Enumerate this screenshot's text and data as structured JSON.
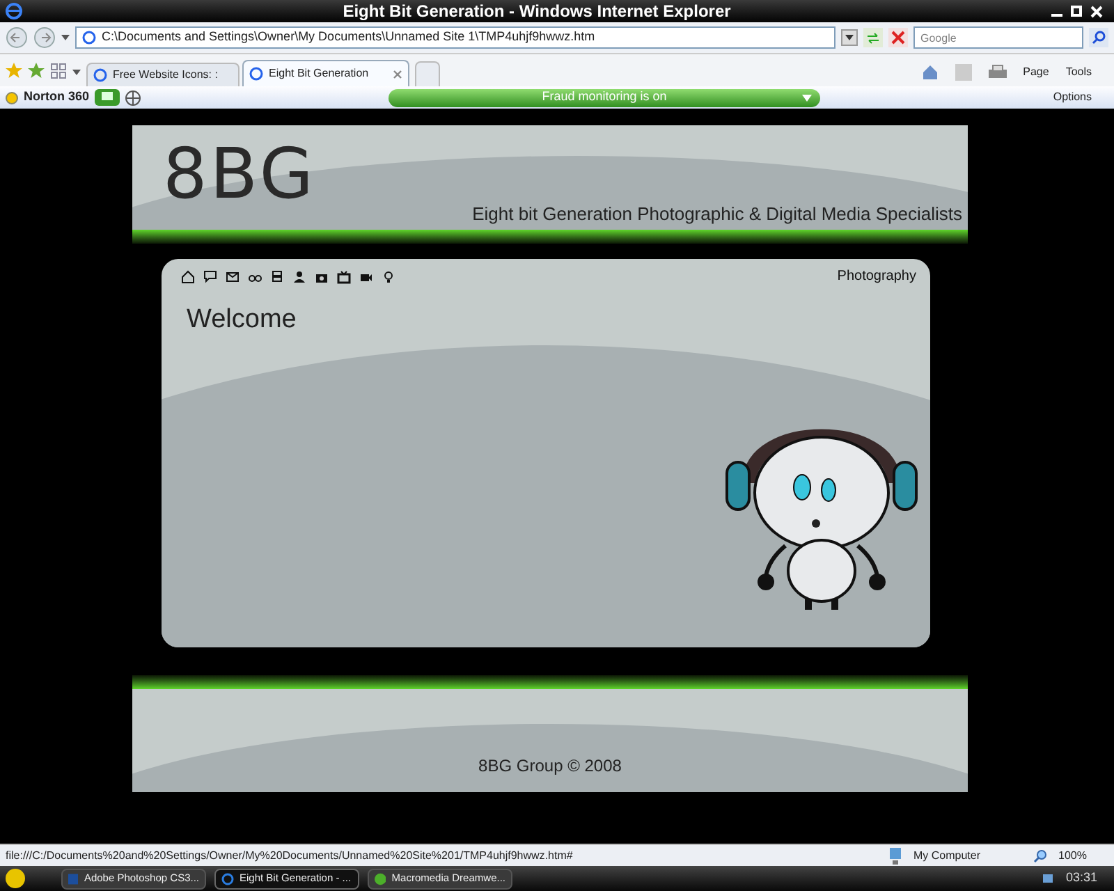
{
  "window": {
    "title": "Eight Bit Generation - Windows Internet Explorer"
  },
  "address_bar": {
    "url": "C:\\Documents and Settings\\Owner\\My Documents\\Unnamed Site 1\\TMP4uhjf9hwwz.htm"
  },
  "search": {
    "placeholder": "Google"
  },
  "tabs": [
    {
      "label": "Free Website Icons: :",
      "selected": false
    },
    {
      "label": "Eight Bit Generation",
      "selected": true
    }
  ],
  "command_bar": [
    "Page",
    "Tools"
  ],
  "norton_bar": {
    "brand": "Norton 360",
    "banner": "Fraud monitoring is on",
    "options": "Options"
  },
  "site": {
    "logo": "8BG",
    "tagline": "Eight bit Generation Photographic & Digital Media Specialists",
    "nav_label": "Photography",
    "heading": "Welcome",
    "footer": "8BG Group © 2008"
  },
  "status_bar": {
    "url": "file:///C:/Documents%20and%20Settings/Owner/My%20Documents/Unnamed%20Site%201/TMP4uhjf9hwwz.htm#",
    "zone": "My Computer",
    "zoom": "100%"
  },
  "taskbar": {
    "items": [
      {
        "label": "Adobe Photoshop CS3...",
        "kind": "photoshop",
        "selected": false
      },
      {
        "label": "Eight Bit Generation - ...",
        "kind": "browser",
        "selected": true
      },
      {
        "label": "Macromedia Dreamwe...",
        "kind": "dreamweaver",
        "selected": false
      }
    ],
    "clock": "03:31"
  }
}
